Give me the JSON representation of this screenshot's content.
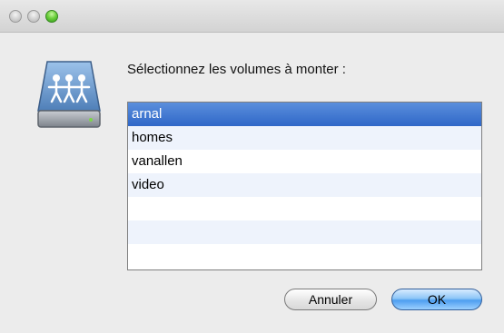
{
  "window": {
    "controls": [
      "close-icon",
      "minimize-icon",
      "zoom-icon"
    ],
    "zoom_color": "#5cc02f"
  },
  "dialog": {
    "icon": "network-drive-icon",
    "prompt": "Sélectionnez les volumes à monter :",
    "volumes": [
      {
        "label": "arnal",
        "selected": true
      },
      {
        "label": "homes",
        "selected": false
      },
      {
        "label": "vanallen",
        "selected": false
      },
      {
        "label": "video",
        "selected": false
      }
    ],
    "buttons": {
      "cancel_label": "Annuler",
      "ok_label": "OK"
    }
  },
  "colors": {
    "selection": "#3a74d0",
    "alt_row": "#eef3fc",
    "window_bg": "#ececec"
  }
}
